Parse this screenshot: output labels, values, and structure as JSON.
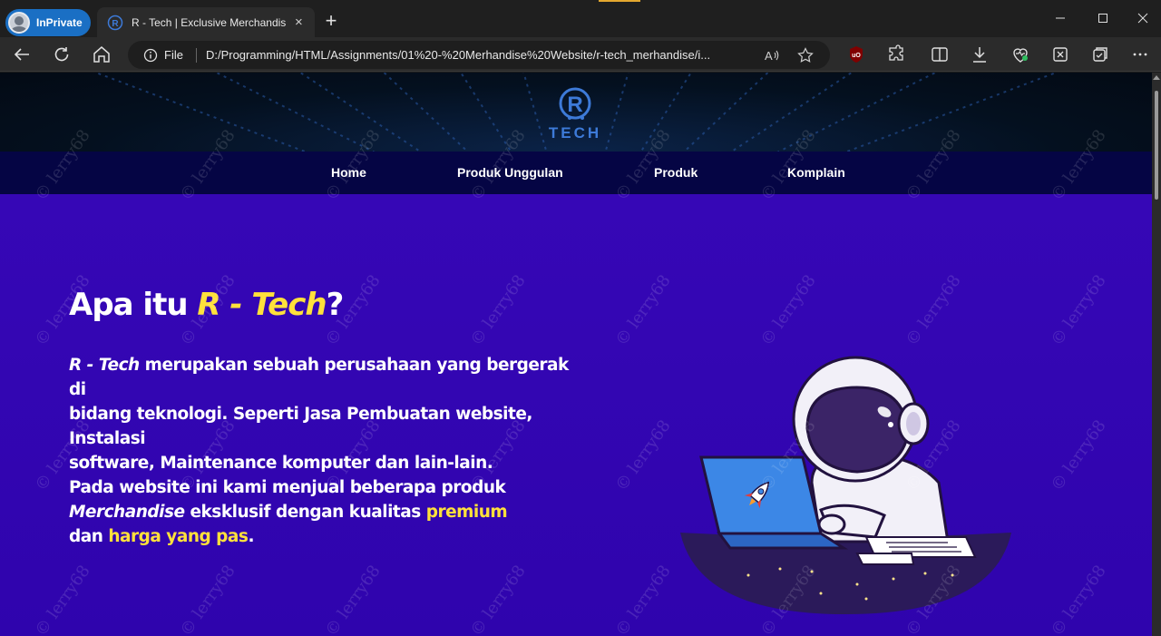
{
  "browser": {
    "inprivate_label": "InPrivate",
    "tab_title": "R - Tech | Exclusive Merchandise",
    "tab_close": "×",
    "new_tab": "+",
    "address_file_label": "File",
    "url": "D:/Programming/HTML/Assignments/01%20-%20Merhandise%20Website/r-tech_merhandise/i...",
    "toolbar_icons": [
      "back-icon",
      "refresh-icon",
      "home-icon",
      "read-aloud-icon",
      "favorite-star-icon",
      "ublock-icon",
      "extensions-icon",
      "split-screen-icon",
      "downloads-icon",
      "browser-essentials-icon",
      "screenshot-icon",
      "collections-icon",
      "more-icon"
    ],
    "window_icons": [
      "minimize-icon",
      "maximize-icon",
      "close-icon"
    ]
  },
  "site": {
    "logo_text": "TECH",
    "logo_letter": "R",
    "nav": [
      "Home",
      "Produk Unggulan",
      "Produk",
      "Komplain"
    ]
  },
  "hero": {
    "title_prefix": "Apa itu ",
    "title_accent": "R - Tech",
    "title_suffix": "?",
    "p1_it": "R - Tech",
    "p1_line1": " merupakan sebuah perusahaan yang bergerak di",
    "p1_line2": "bidang teknologi. Seperti Jasa Pembuatan website, Instalasi",
    "p1_line3": "software, Maintenance komputer dan lain-lain.",
    "p2_line1": "Pada website ini kami menjual beberapa produk",
    "p2_it": "Merchandise",
    "p2_mid": " eksklusif dengan kualitas ",
    "p2_hl1": "premium",
    "p2_line3_pre": "dan ",
    "p2_hl2": "harga yang pas",
    "p2_end": "."
  },
  "watermark_text": "© lerry68",
  "colors": {
    "accent_yellow": "#ffe13b",
    "hero_bg": "#3104b0",
    "nav_bg": "#050544",
    "logo_blue": "#3d7ad8"
  }
}
